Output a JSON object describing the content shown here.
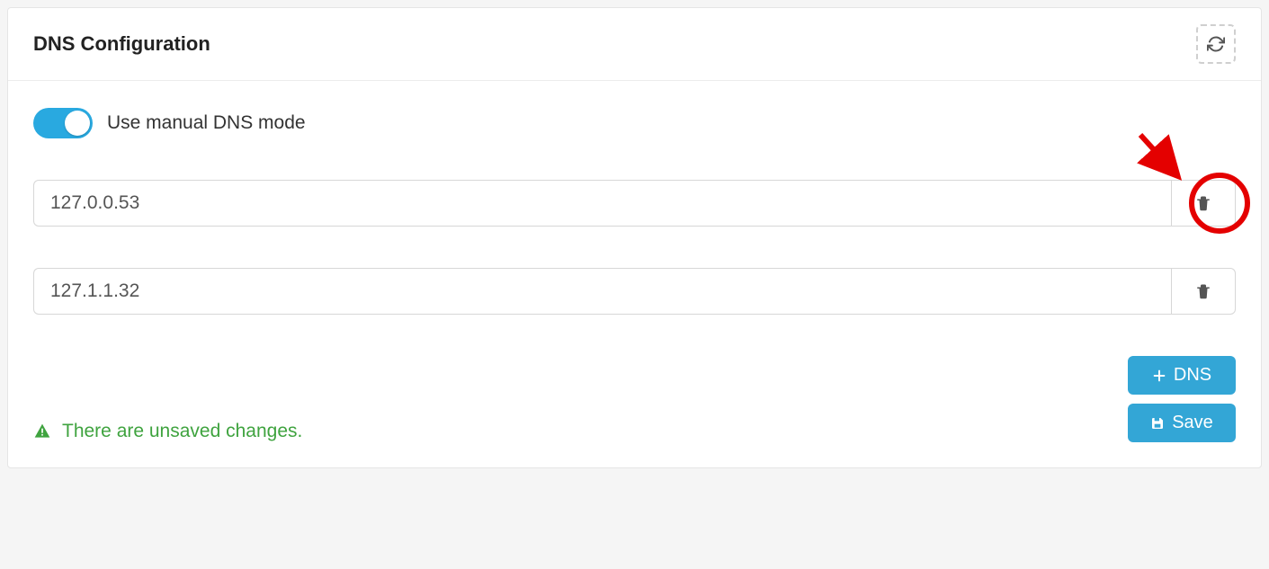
{
  "header": {
    "title": "DNS Configuration"
  },
  "toggle": {
    "label": "Use manual DNS mode",
    "on": true
  },
  "dns_entries": [
    {
      "value": "127.0.0.53",
      "highlighted": true
    },
    {
      "value": "127.1.1.32",
      "highlighted": false
    }
  ],
  "status": {
    "message": "There are unsaved changes."
  },
  "buttons": {
    "add_label": "DNS",
    "save_label": "Save"
  },
  "colors": {
    "accent": "#33a6d6",
    "toggle": "#29a9e0",
    "success": "#3fa33f",
    "annotation": "#e40000"
  }
}
